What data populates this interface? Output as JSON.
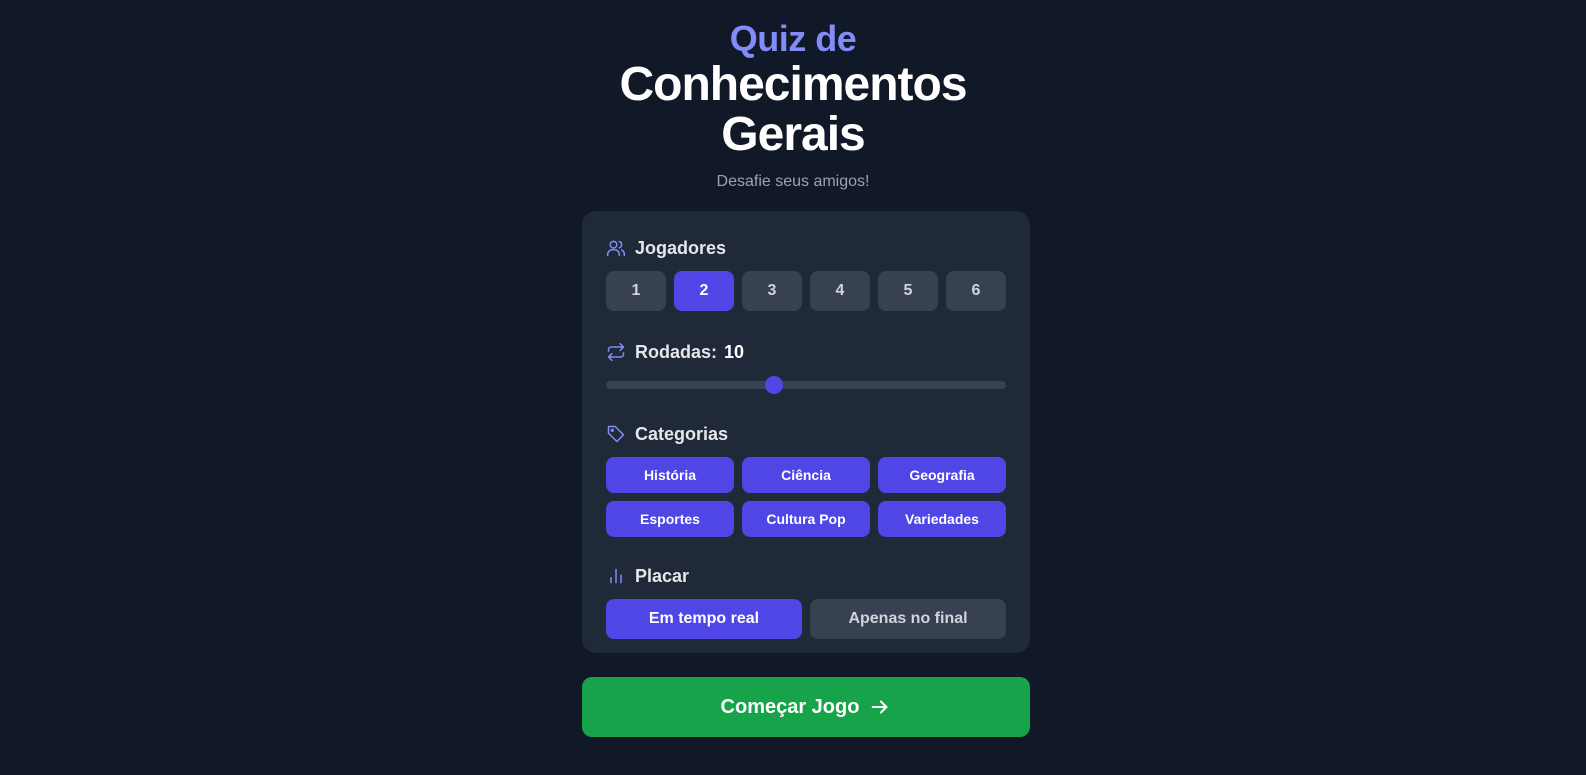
{
  "header": {
    "title_pre": "Quiz de",
    "title_main_line1": "Conhecimentos",
    "title_main_line2": "Gerais",
    "subtitle": "Desafie seus amigos!"
  },
  "players": {
    "label": "Jogadores",
    "icon": "users-icon",
    "options": [
      "1",
      "2",
      "3",
      "4",
      "5",
      "6"
    ],
    "selected": "2"
  },
  "rounds": {
    "label": "Rodadas:",
    "value": "10",
    "icon": "repeat-icon",
    "slider_fraction": 0.42
  },
  "categories": {
    "label": "Categorias",
    "icon": "tag-icon",
    "items": [
      "História",
      "Ciência",
      "Geografia",
      "Esportes",
      "Cultura Pop",
      "Variedades"
    ]
  },
  "scoreboard": {
    "label": "Placar",
    "icon": "bar-chart-icon",
    "options": [
      "Em tempo real",
      "Apenas no final"
    ],
    "selected": "Em tempo real"
  },
  "start": {
    "label": "Começar Jogo",
    "icon": "arrow-right-icon"
  },
  "colors": {
    "background": "#111827",
    "card": "#1f2937",
    "accent": "#4f46e5",
    "accent_light": "#818cf8",
    "start": "#16a34a",
    "inactive": "#374151"
  }
}
